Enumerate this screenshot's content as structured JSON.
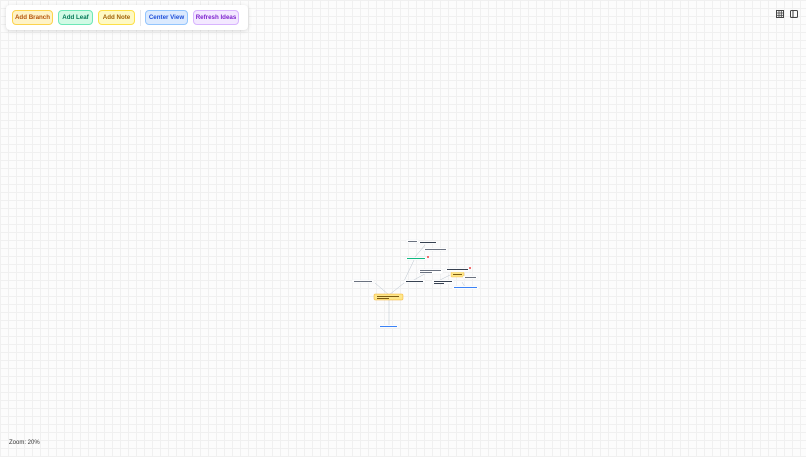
{
  "toolbar": {
    "buttons": [
      {
        "label": "Add Branch",
        "bg": "#fef3c7",
        "border": "#fcd34d",
        "color": "#b45309"
      },
      {
        "label": "Add Leaf",
        "bg": "#d1fae5",
        "border": "#6ee7b7",
        "color": "#047857"
      },
      {
        "label": "Add Note",
        "bg": "#fef9c3",
        "border": "#fde047",
        "color": "#a16207"
      },
      {
        "label": "Center View",
        "bg": "#dbeafe",
        "border": "#93c5fd",
        "color": "#1d4ed8"
      },
      {
        "label": "Refresh Ideas",
        "bg": "#f3e8ff",
        "border": "#d8b4fe",
        "color": "#7e22ce"
      }
    ]
  },
  "icons": {
    "grid": "grid-icon",
    "sidebar": "sidebar-toggle-icon"
  },
  "status": {
    "zoom_label": "Zoom: 20%"
  }
}
